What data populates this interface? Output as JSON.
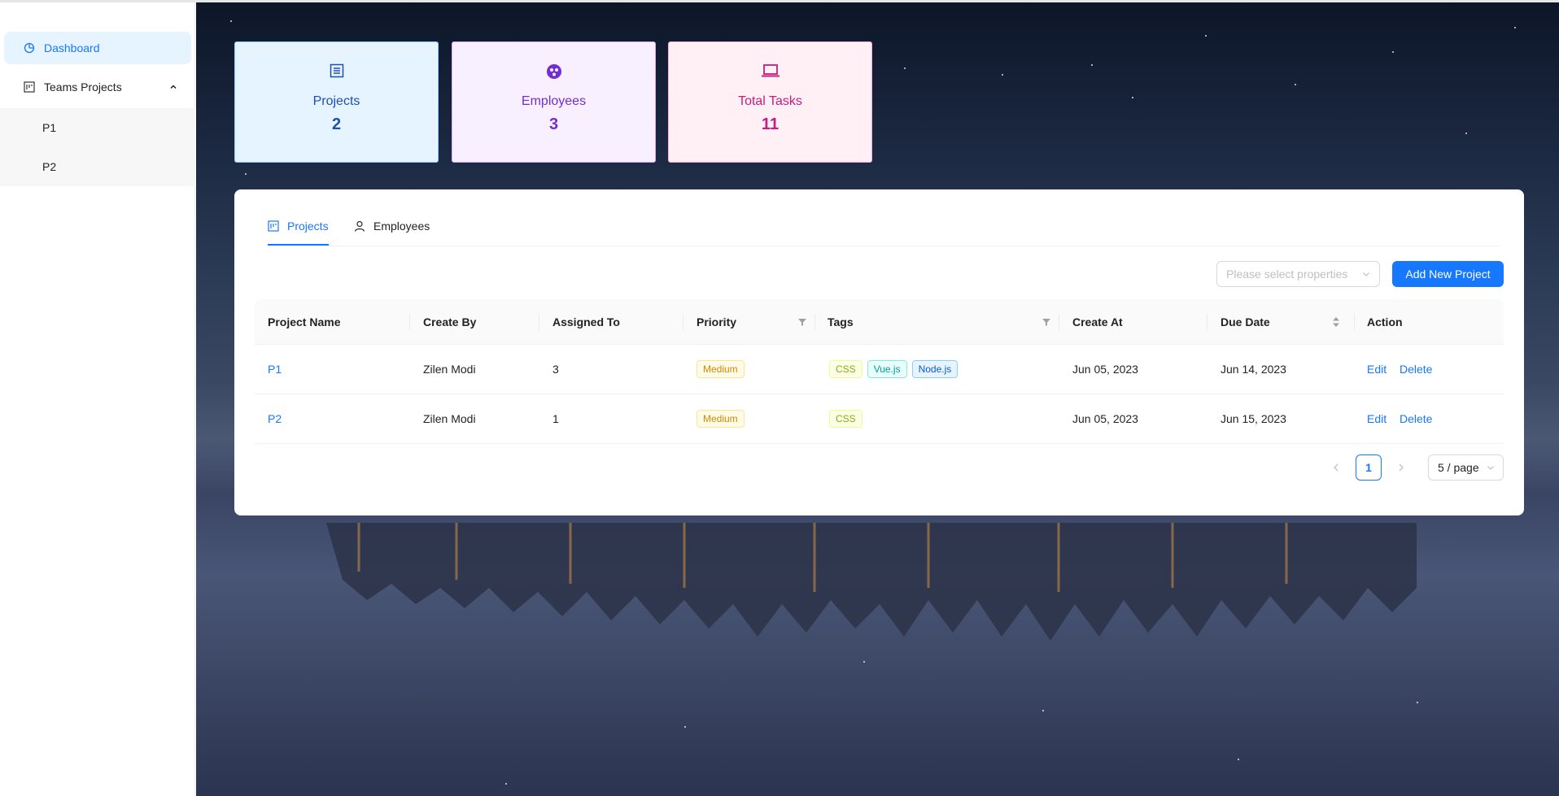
{
  "sidebar": {
    "items": [
      {
        "label": "Dashboard",
        "icon": "pie-chart-icon"
      },
      {
        "label": "Teams Projects",
        "icon": "project-icon"
      }
    ],
    "sub_items": [
      {
        "label": "P1"
      },
      {
        "label": "P2"
      }
    ]
  },
  "stats": [
    {
      "label": "Projects",
      "value": "2",
      "icon": "list-icon",
      "color": "#1d4fb8"
    },
    {
      "label": "Employees",
      "value": "3",
      "icon": "team-icon",
      "color": "#722ed1"
    },
    {
      "label": "Total Tasks",
      "value": "11",
      "icon": "laptop-icon",
      "color": "#c41d7f"
    }
  ],
  "tabs": [
    {
      "label": "Projects",
      "icon": "project-icon",
      "active": true
    },
    {
      "label": "Employees",
      "icon": "user-icon",
      "active": false
    }
  ],
  "toolbar": {
    "select_placeholder": "Please select properties",
    "add_button": "Add New Project"
  },
  "table": {
    "columns": [
      "Project Name",
      "Create By",
      "Assigned To",
      "Priority",
      "Tags",
      "Create At",
      "Due Date",
      "Action"
    ],
    "rows": [
      {
        "name": "P1",
        "create_by": "Zilen Modi",
        "assigned_to": "3",
        "priority": "Medium",
        "tags": [
          "CSS",
          "Vue.js",
          "Node.js"
        ],
        "create_at": "Jun 05, 2023",
        "due_date": "Jun 14, 2023",
        "edit": "Edit",
        "delete": "Delete"
      },
      {
        "name": "P2",
        "create_by": "Zilen Modi",
        "assigned_to": "1",
        "priority": "Medium",
        "tags": [
          "CSS"
        ],
        "create_at": "Jun 05, 2023",
        "due_date": "Jun 15, 2023",
        "edit": "Edit",
        "delete": "Delete"
      }
    ]
  },
  "pagination": {
    "current_page": "1",
    "page_size": "5 / page"
  },
  "colors": {
    "primary": "#1677ff",
    "medium_tag": "#d48806"
  }
}
